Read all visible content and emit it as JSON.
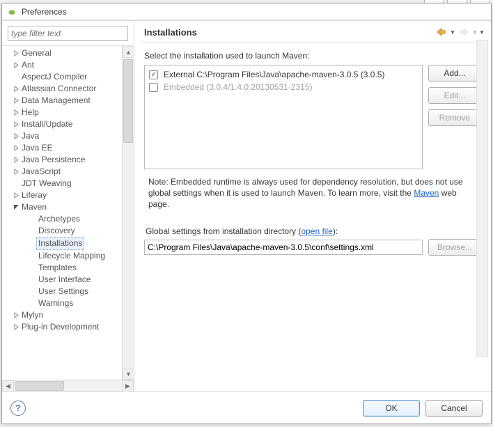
{
  "window": {
    "title": "Preferences"
  },
  "win_controls": {
    "minimize": "─",
    "maximize": "▢",
    "close": "✕"
  },
  "filter": {
    "placeholder": "type filter text"
  },
  "tree": [
    {
      "label": "General",
      "depth": 0,
      "expandable": true,
      "expanded": false
    },
    {
      "label": "Ant",
      "depth": 0,
      "expandable": true,
      "expanded": false
    },
    {
      "label": "AspectJ Compiler",
      "depth": 0,
      "expandable": false
    },
    {
      "label": "Atlassian Connector",
      "depth": 0,
      "expandable": true,
      "expanded": false
    },
    {
      "label": "Data Management",
      "depth": 0,
      "expandable": true,
      "expanded": false
    },
    {
      "label": "Help",
      "depth": 0,
      "expandable": true,
      "expanded": false
    },
    {
      "label": "Install/Update",
      "depth": 0,
      "expandable": true,
      "expanded": false
    },
    {
      "label": "Java",
      "depth": 0,
      "expandable": true,
      "expanded": false
    },
    {
      "label": "Java EE",
      "depth": 0,
      "expandable": true,
      "expanded": false
    },
    {
      "label": "Java Persistence",
      "depth": 0,
      "expandable": true,
      "expanded": false
    },
    {
      "label": "JavaScript",
      "depth": 0,
      "expandable": true,
      "expanded": false
    },
    {
      "label": "JDT Weaving",
      "depth": 0,
      "expandable": false
    },
    {
      "label": "Liferay",
      "depth": 0,
      "expandable": true,
      "expanded": false
    },
    {
      "label": "Maven",
      "depth": 0,
      "expandable": true,
      "expanded": true
    },
    {
      "label": "Archetypes",
      "depth": 1,
      "expandable": false
    },
    {
      "label": "Discovery",
      "depth": 1,
      "expandable": false
    },
    {
      "label": "Installations",
      "depth": 1,
      "expandable": false,
      "selected": true
    },
    {
      "label": "Lifecycle Mapping",
      "depth": 1,
      "expandable": false
    },
    {
      "label": "Templates",
      "depth": 1,
      "expandable": false
    },
    {
      "label": "User Interface",
      "depth": 1,
      "expandable": false
    },
    {
      "label": "User Settings",
      "depth": 1,
      "expandable": false
    },
    {
      "label": "Warnings",
      "depth": 1,
      "expandable": false
    },
    {
      "label": "Mylyn",
      "depth": 0,
      "expandable": true,
      "expanded": false
    },
    {
      "label": "Plug-in Development",
      "depth": 0,
      "expandable": true,
      "expanded": false
    }
  ],
  "page": {
    "title": "Installations",
    "select_label": "Select the installation used to launch Maven:",
    "installs": [
      {
        "checked": true,
        "label": "External C:\\Program Files\\Java\\apache-maven-3.0.5 (3.0.5)",
        "disabled": false
      },
      {
        "checked": false,
        "label": "Embedded (3.0.4/1.4.0.20130531-2315)",
        "disabled": true
      }
    ],
    "buttons": {
      "add": "Add...",
      "edit": "Edit...",
      "remove": "Remove"
    },
    "note_pre": "Note: Embedded runtime is always used for dependency resolution, but does not use global settings when it is used to launch Maven. To learn more, visit the ",
    "note_link": "Maven",
    "note_post": " web page.",
    "global_pre": "Global settings from installation directory (",
    "global_link": "open file",
    "global_post": "):",
    "global_value": "C:\\Program Files\\Java\\apache-maven-3.0.5\\conf\\settings.xml",
    "browse": "Browse..."
  },
  "footer": {
    "ok": "OK",
    "cancel": "Cancel"
  }
}
